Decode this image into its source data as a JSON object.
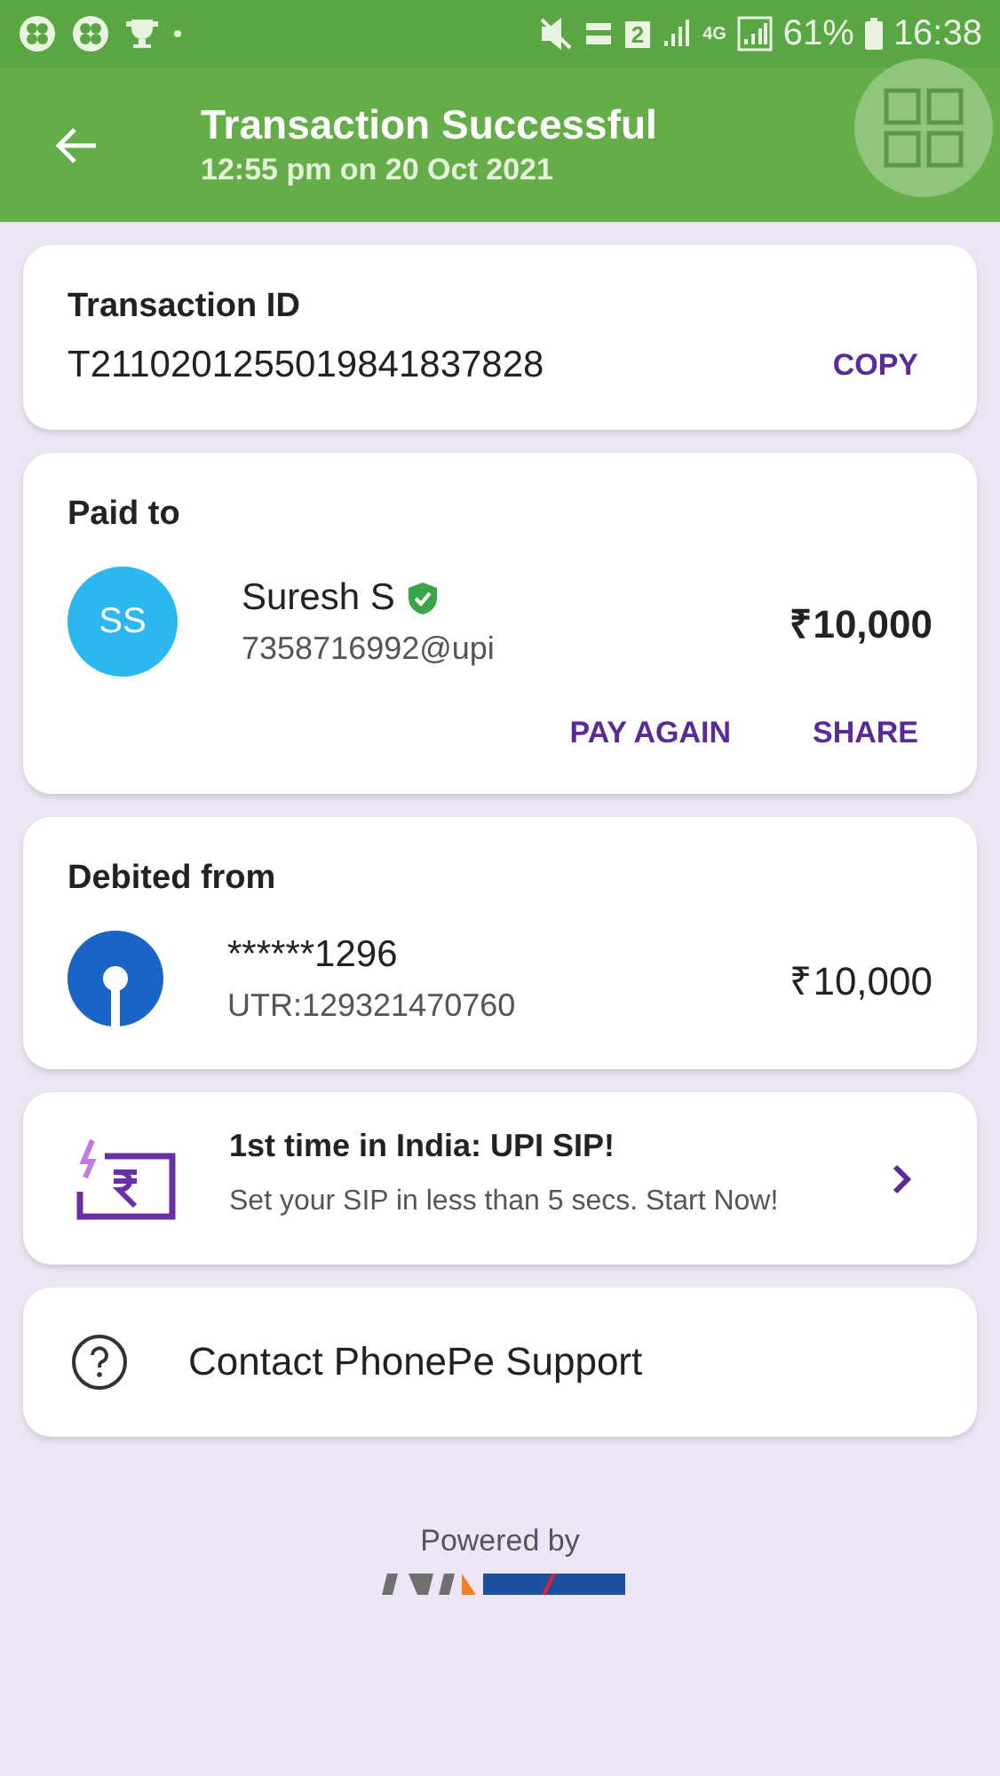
{
  "status_bar": {
    "battery": "61%",
    "time": "16:38",
    "sim": "2",
    "network": "4G"
  },
  "header": {
    "title": "Transaction Successful",
    "subtitle": "12:55 pm on 20 Oct 2021"
  },
  "transaction": {
    "label": "Transaction ID",
    "id": "T2110201255019841837828",
    "action": "COPY"
  },
  "paid_to": {
    "label": "Paid to",
    "initials": "SS",
    "name": "Suresh S",
    "verified": true,
    "upi_id": "7358716992@upi",
    "amount": "₹10,000",
    "actions": [
      "PAY AGAIN",
      "SHARE"
    ]
  },
  "debited_from": {
    "label": "Debited from",
    "account": "******1296",
    "utr": "UTR:129321470760",
    "amount": "₹10,000"
  },
  "promo": {
    "title": "1st time in India: UPI SIP!",
    "text": "Set your SIP in less than 5 secs. Start Now!"
  },
  "support": {
    "label": "Contact PhonePe Support"
  },
  "footer": {
    "text": "Powered by"
  }
}
